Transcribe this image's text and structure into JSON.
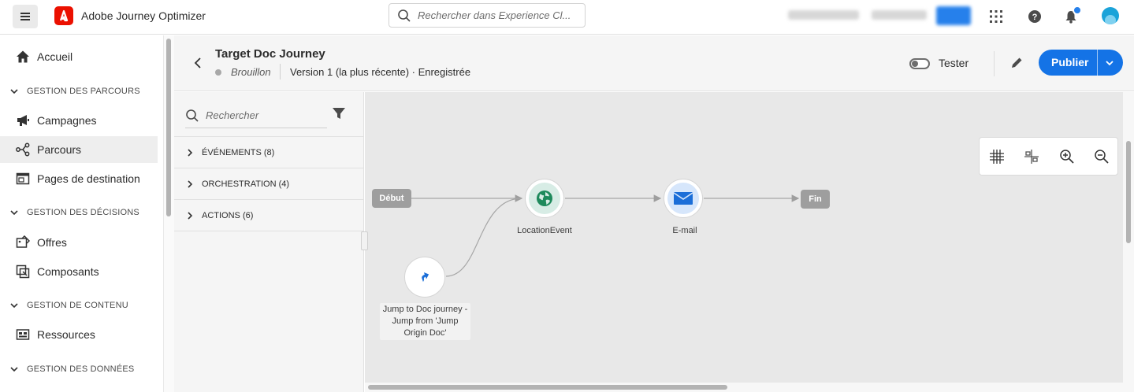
{
  "app": {
    "title": "Adobe Journey Optimizer",
    "search_placeholder": "Rechercher dans Experience Cl...",
    "brand_color": "#eb1000",
    "accent_color": "#1473e6"
  },
  "nav": {
    "items": [
      {
        "label": "Accueil",
        "icon": "home-icon"
      },
      {
        "label": "Campagnes",
        "icon": "megaphone-icon"
      },
      {
        "label": "Parcours",
        "icon": "journey-icon",
        "active": true
      },
      {
        "label": "Pages de destination",
        "icon": "page-icon"
      },
      {
        "label": "Offres",
        "icon": "offer-icon"
      },
      {
        "label": "Composants",
        "icon": "components-icon"
      },
      {
        "label": "Ressources",
        "icon": "assets-icon"
      }
    ],
    "sections": [
      "GESTION DES PARCOURS",
      "GESTION DES DÉCISIONS",
      "GESTION DE CONTENU",
      "GESTION DES DONNÉES"
    ]
  },
  "journey": {
    "name": "Target Doc Journey",
    "status": "Brouillon",
    "version": "Version 1 (la plus récente) · Enregistrée",
    "test_label": "Tester",
    "publish_label": "Publier"
  },
  "palette": {
    "search_placeholder": "Rechercher",
    "groups": [
      "ÉVÉNEMENTS (8)",
      "ORCHESTRATION (4)",
      "ACTIONS (6)"
    ]
  },
  "canvas": {
    "start_label": "Début",
    "end_label": "Fin",
    "nodes": {
      "location": "LocationEvent",
      "email": "E-mail",
      "jump": "Jump to Doc journey - Jump from 'Jump Origin Doc'"
    }
  }
}
